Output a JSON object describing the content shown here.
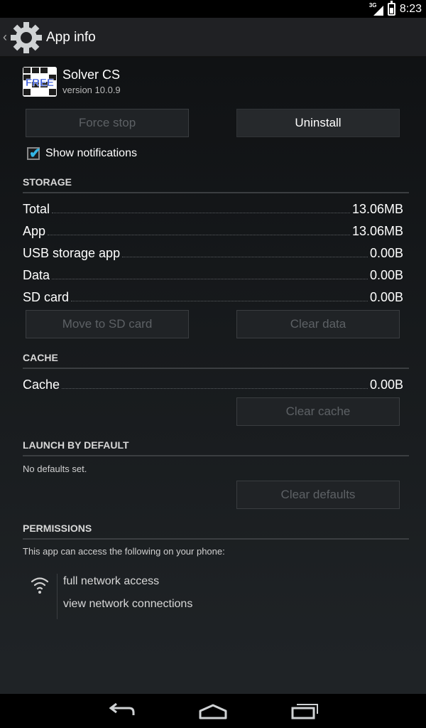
{
  "status_bar": {
    "network_type": "3G",
    "time": "8:23"
  },
  "action_bar": {
    "title": "App info",
    "icon": "gear-icon"
  },
  "app": {
    "name": "Solver CS",
    "version": "version 10.0.9",
    "icon_text": "FREE"
  },
  "buttons": {
    "force_stop": "Force stop",
    "uninstall": "Uninstall",
    "move_to_sd": "Move to SD card",
    "clear_data": "Clear data",
    "clear_cache": "Clear cache",
    "clear_defaults": "Clear defaults"
  },
  "notifications": {
    "label": "Show notifications",
    "checked": true
  },
  "storage": {
    "header": "STORAGE",
    "rows": [
      {
        "label": "Total",
        "value": "13.06MB"
      },
      {
        "label": "App",
        "value": "13.06MB"
      },
      {
        "label": "USB storage app",
        "value": "0.00B"
      },
      {
        "label": "Data",
        "value": "0.00B"
      },
      {
        "label": "SD card",
        "value": "0.00B"
      }
    ]
  },
  "cache": {
    "header": "CACHE",
    "label": "Cache",
    "value": "0.00B"
  },
  "launch": {
    "header": "LAUNCH BY DEFAULT",
    "text": "No defaults set."
  },
  "permissions": {
    "header": "PERMISSIONS",
    "intro": "This app can access the following on your phone:",
    "items": [
      "full network access",
      "view network connections"
    ]
  },
  "colors": {
    "accent": "#33b5e5",
    "background": "#1f2326"
  }
}
